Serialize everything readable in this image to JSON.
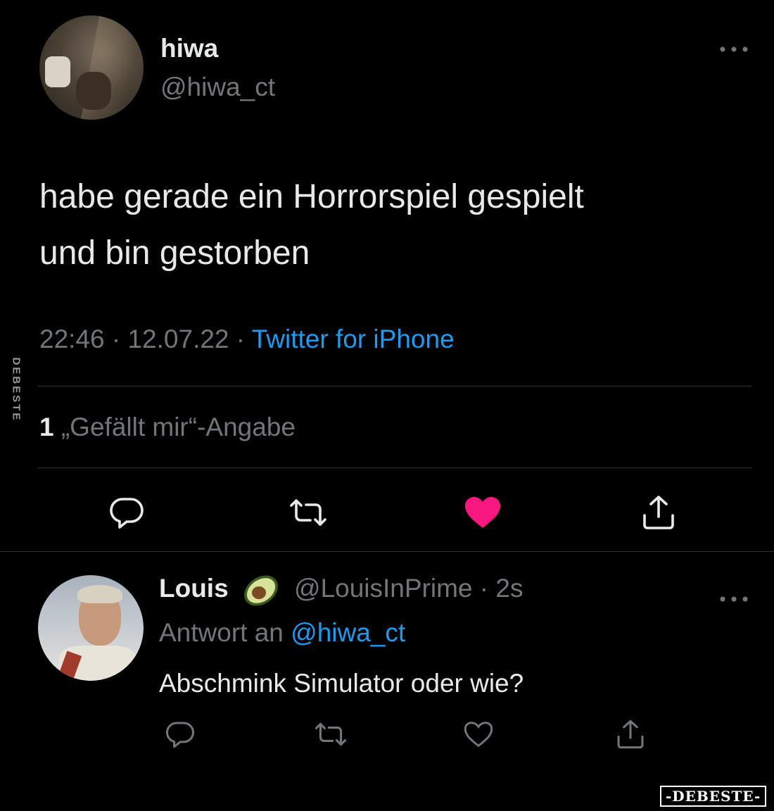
{
  "tweet": {
    "author": {
      "display_name": "hiwa",
      "handle": "@hiwa_ct"
    },
    "more_icon": "more-horizontal-icon",
    "text_line1": "habe gerade ein Horrorspiel gespielt",
    "text_line2": "und bin gestorben",
    "time": "22:46",
    "sep1": " · ",
    "date": "12.07.22",
    "sep2": " · ",
    "source": "Twitter for iPhone",
    "likes_count": "1",
    "likes_label": " „Gefällt mir“-Angabe",
    "liked": true,
    "colors": {
      "accent": "#1d9bf0",
      "like": "#f91880",
      "muted": "#71767b",
      "text": "#e7e9ea",
      "border": "#2f3336"
    },
    "actions": [
      "reply-icon",
      "retweet-icon",
      "like-icon",
      "share-icon"
    ]
  },
  "reply": {
    "author": {
      "display_name": "Louis",
      "emoji": "avocado-icon",
      "handle_time": "@LouisInPrime · 2s"
    },
    "reply_to_label": "Antwort an ",
    "reply_to_mention": "@hiwa_ct",
    "text": "Abschmink Simulator oder wie?",
    "more_icon": "more-horizontal-icon",
    "actions": [
      "reply-icon",
      "retweet-icon",
      "like-icon",
      "share-icon"
    ]
  },
  "watermarks": {
    "side": "DEBESTE",
    "corner": "-DEBESTE-"
  }
}
